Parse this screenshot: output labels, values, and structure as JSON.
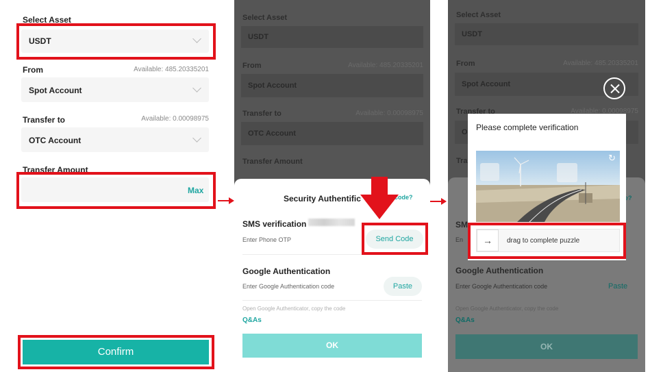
{
  "panel1": {
    "select_asset_label": "Select Asset",
    "asset_value": "USDT",
    "from_label": "From",
    "from_available": "Available: 485.20335201",
    "from_value": "Spot Account",
    "to_label": "Transfer to",
    "to_available": "Available: 0.00098975",
    "to_value": "OTC Account",
    "amount_label": "Transfer Amount",
    "amount_value": "",
    "max_label": "Max",
    "confirm_label": "Confirm"
  },
  "panel2": {
    "bg": {
      "select_asset_label": "Select Asset",
      "asset_value": "USDT",
      "from_label": "From",
      "from_available": "Available: 485.20335201",
      "from_value": "Spot Account",
      "to_label": "Transfer to",
      "to_available": "Available: 0.00098975",
      "to_value": "OTC Account",
      "amount_label": "Transfer Amount"
    },
    "sheet_title": "Security Authentific",
    "code_link": "code?",
    "sms_title": "SMS verification",
    "sms_sub": "Enter Phone OTP",
    "send_code_label": "Send Code",
    "google_title": "Google Authentication",
    "google_sub": "Enter Google Authentication code",
    "paste_label": "Paste",
    "hint": "Open Google Authenticator, copy the code",
    "qa_label": "Q&As",
    "ok_label": "OK"
  },
  "panel3": {
    "bg": {
      "select_asset_label": "Select Asset",
      "asset_value": "USDT",
      "from_label": "From",
      "from_available": "Available: 485.20335201",
      "from_value": "Spot Account",
      "to_label": "Transfer to",
      "to_available": "Available: 0.00098975",
      "to_value": "O",
      "amount_label": "Tra",
      "sms_partial": "SM",
      "sms_sub_partial": "En",
      "question_partial": "e?",
      "google_title": "Google Authentication",
      "google_sub": "Enter Google Authentication code",
      "paste_label": "Paste",
      "hint": "Open Google Authenticator, copy the code",
      "qa_label": "Q&As",
      "ok_label": "OK"
    },
    "modal_title": "Please complete verification",
    "slider_text": "drag to complete puzzle",
    "arrow_glyph": "→",
    "refresh_glyph": "↻",
    "close_glyph": ""
  },
  "colors": {
    "accent": "#17b3a6",
    "highlight_red": "#e2121b",
    "overlay": "#555555"
  }
}
